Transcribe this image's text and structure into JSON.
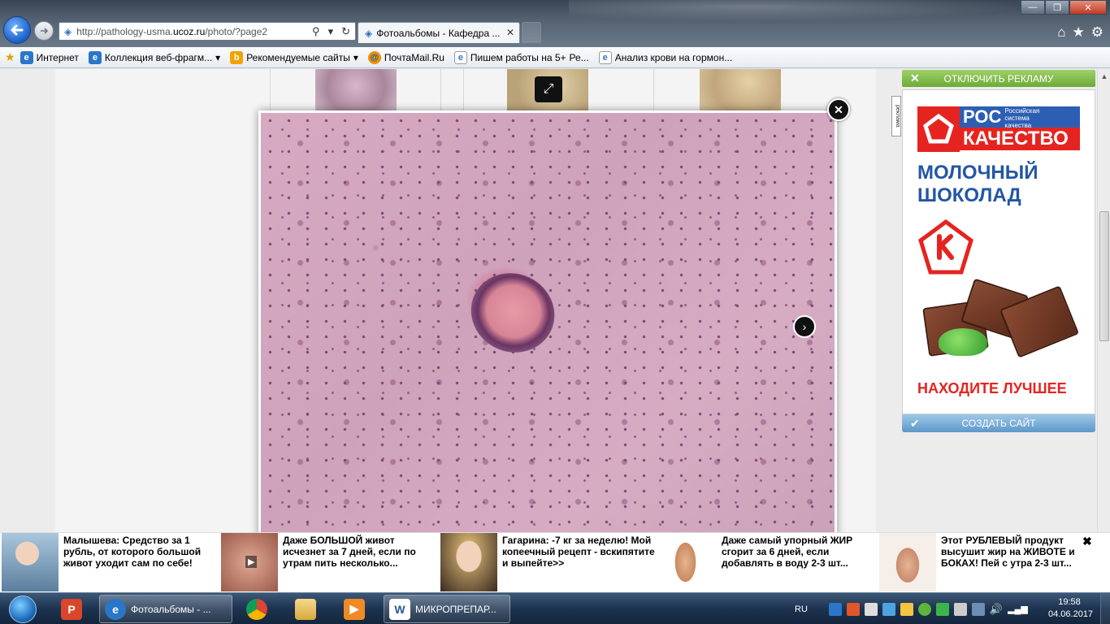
{
  "browser": {
    "address_url_prefix": "http://pathology-usma.",
    "address_url_host": "ucoz.ru",
    "address_url_path": "/photo/?page2",
    "active_tab_title": "Фотоальбомы - Кафедра ...",
    "window_controls": {
      "minimize": "—",
      "maximize": "❐",
      "close": "✕"
    }
  },
  "favorites_bar": {
    "items": [
      {
        "label": "Интернет",
        "icon": "ie-icon"
      },
      {
        "label": "Коллекция веб-фрагм...",
        "icon": "ie-icon",
        "dropdown": true
      },
      {
        "label": "Рекомендуемые сайты",
        "icon": "bing-icon",
        "dropdown": true
      },
      {
        "label": "ПочтаMail.Ru",
        "icon": "mailru-icon"
      },
      {
        "label": "Пишем работы на 5+",
        "icon": "page-icon"
      },
      {
        "label": "Ре...",
        "icon": ""
      },
      {
        "label": "Анализ крови на гормон...",
        "icon": "ie-icon"
      }
    ]
  },
  "lightbox": {
    "image_alt": "Микропрепарат: ткань мозга, окраска гематоксилин-эозин",
    "close_symbol": "✕",
    "next_symbol": "›",
    "expand_symbol": "⤢"
  },
  "right_ad": {
    "top_button": "ОТКЛЮЧИТЬ РЕКЛАМУ",
    "label": "реклама",
    "brand_short": "РОС",
    "brand_sub_1": "Российская",
    "brand_sub_2": "система",
    "brand_sub_3": "качества",
    "brand_word": "КАЧЕСТВО",
    "product_line1": "МОЛОЧНЫЙ",
    "product_line2": "ШОКОЛАД",
    "cta": "НАХОДИТЕ ЛУЧШЕЕ",
    "bottom_button": "СОЗДАТЬ САЙТ",
    "colors": {
      "red": "#e52420",
      "blue": "#2356a5",
      "green": "#6cab36"
    }
  },
  "news_strip": {
    "items": [
      {
        "text": "Малышева: Средство за 1 рубль, от которого большой живот уходит сам по себе!"
      },
      {
        "text": "Даже БОЛЬШОЙ живот исчезнет за 7 дней, если по утрам пить несколько..."
      },
      {
        "text": "Гагарина: -7 кг за неделю! Мой копеечный рецепт - вскипятите и выпейте>>"
      },
      {
        "text": "Даже самый упорный ЖИР сгорит за 6 дней, если добавлять в воду 2-3 шт..."
      },
      {
        "text": "Этот РУБЛЕВЫЙ продукт высушит жир на ЖИВОТЕ и БОКАХ! Пей с утра 2-3 шт..."
      }
    ],
    "close_symbol": "✖"
  },
  "taskbar": {
    "ie_window_title": "Фотоальбомы - ...",
    "word_window_title": "МИКРОПРЕПАР...",
    "language": "RU",
    "time": "19:58",
    "date": "04.06.2017"
  }
}
